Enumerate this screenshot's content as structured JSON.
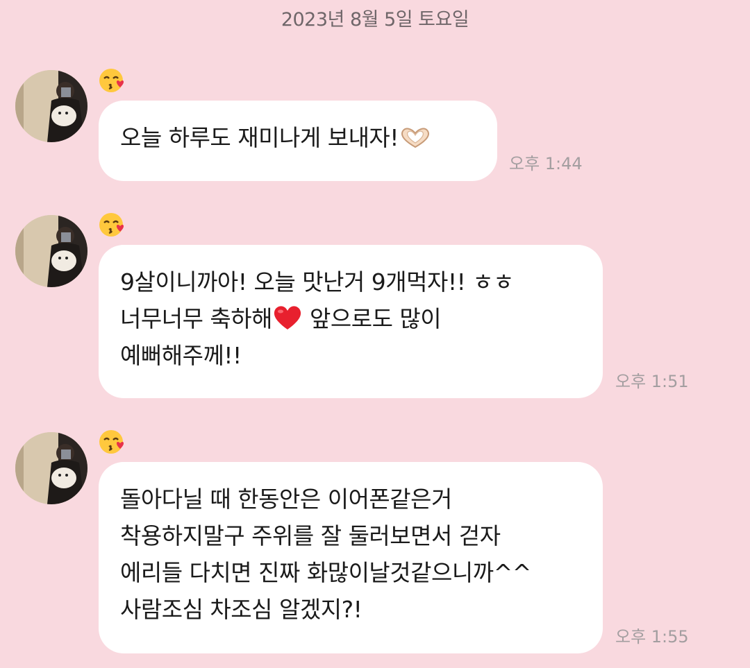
{
  "date_divider": "2023년 8월 5일 토요일",
  "sender": {
    "avatar_icon": "profile-photo-mirror-selfie-with-dog",
    "name_icon": "kissing-face-wink-emoji"
  },
  "colors": {
    "background": "#f9d9df",
    "bubble": "#ffffff",
    "time_text": "#a39ea0",
    "date_text": "#6f6669"
  },
  "messages": [
    {
      "lines": [
        "오늘 하루도 재미나게 보내자!"
      ],
      "trailing_icon": "heart-hands-emoji",
      "time": "오후 1:44"
    },
    {
      "lines": [
        "9살이니까아! 오늘 맛난거 9개먹자!! ㅎㅎ",
        "너무너무 축하해",
        "예뻐해주께!!"
      ],
      "line2_icon": "red-heart-emoji",
      "line2_rest": " 앞으로도 많이",
      "time": "오후 1:51"
    },
    {
      "lines": [
        "돌아다닐 때 한동안은 이어폰같은거",
        "착용하지말구 주위를 잘 둘러보면서 걷자",
        "에리들 다치면 진짜 화많이날것같으니까^^",
        "사람조심 차조심 알겠지?!"
      ],
      "time": "오후 1:55"
    }
  ]
}
